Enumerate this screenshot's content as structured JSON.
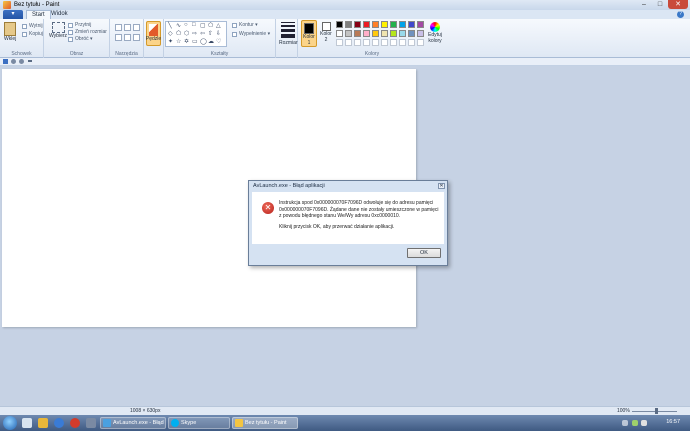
{
  "window": {
    "title": "Bez tytułu - Paint",
    "minimize": "–",
    "maximize": "□",
    "close": "✕"
  },
  "tabs": {
    "file": "▾",
    "start": "Start",
    "view": "Widok",
    "help": "?"
  },
  "ribbon": {
    "clipboard": {
      "paste": "Wklej",
      "cut": "Wytnij",
      "copy": "Kopiuj",
      "label": "Schowek"
    },
    "image": {
      "select": "Wybierz",
      "crop": "Przytnij",
      "resize": "Zmień rozmiar",
      "rotate": "Obróć ▾",
      "label": "Obraz"
    },
    "tools": {
      "label": "Narzędzia"
    },
    "brushes": {
      "label": "Pędzle"
    },
    "shapes": {
      "outline": "Kontur ▾",
      "fill": "Wypełnienie ▾",
      "label": "Kształty"
    },
    "size": {
      "label": "Rozmiar"
    },
    "colors": {
      "color1": "Kolor 1",
      "color2": "Kolor 2",
      "edit": "Edytuj kolory",
      "label": "Kolory",
      "palette": [
        "#000000",
        "#7f7f7f",
        "#880015",
        "#ed1c24",
        "#ff7f27",
        "#fff200",
        "#22b14c",
        "#00a2e8",
        "#3f48cc",
        "#a349a4",
        "#ffffff",
        "#c3c3c3",
        "#b97a57",
        "#ffaec9",
        "#ffc90e",
        "#efe4b0",
        "#b5e61d",
        "#99d9ea",
        "#7092be",
        "#c8bfe7"
      ]
    }
  },
  "dialog": {
    "title": "AvLaunch.exe - Błąd aplikacji",
    "close": "✕",
    "message1": "Instrukcja spod 0x000000070F7096D odwołuje się do adresu pamięci 0x000000070F7096D. Żądane dane nie zostały umieszczone w pamięci z powodu błędnego stanu We/Wy adresu 0xc0000010.",
    "message2": "Kliknij przycisk OK, aby przerwać działanie aplikacji.",
    "ok": "OK"
  },
  "statusbar": {
    "dimensions": "1008 × 630px",
    "zoom": "100%"
  },
  "taskbar": {
    "tasks": [
      "AvLaunch.exe - Błąd ...",
      "Skype",
      "Bez tytułu - Paint"
    ],
    "clock": "16:57"
  }
}
